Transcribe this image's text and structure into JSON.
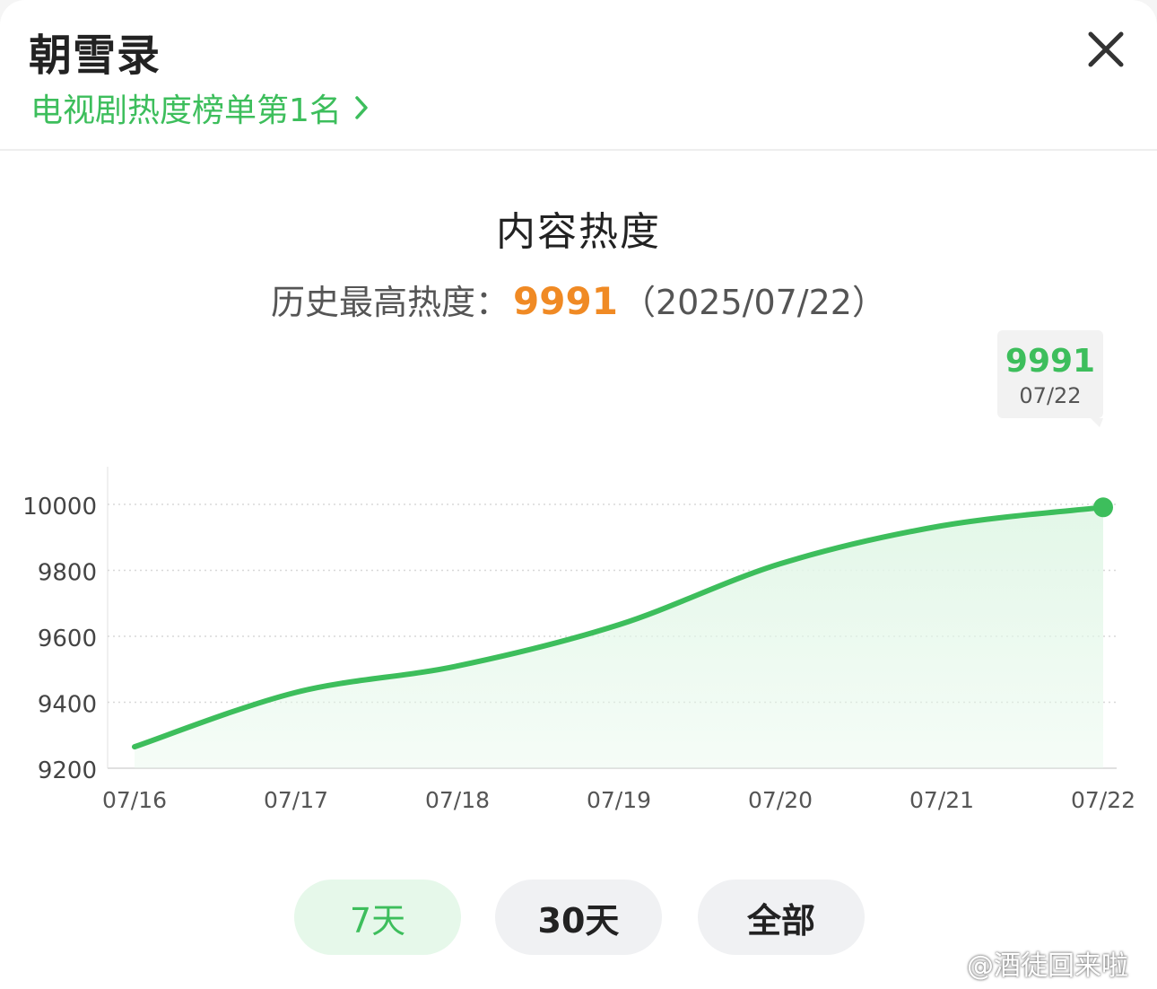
{
  "header": {
    "title": "朝雪录",
    "rank_link": "电视剧热度榜单第1名"
  },
  "heat": {
    "title": "内容热度",
    "peak_label": "历史最高热度：",
    "peak_value": "9991",
    "peak_date": "（2025/07/22）"
  },
  "tooltip": {
    "value": "9991",
    "date": "07/22"
  },
  "chart_data": {
    "type": "area",
    "title": "",
    "xlabel": "",
    "ylabel": "",
    "x": [
      "07/16",
      "07/17",
      "07/18",
      "07/19",
      "07/20",
      "07/21",
      "07/22"
    ],
    "y_ticks": [
      "9200",
      "9400",
      "9600",
      "9800",
      "10000"
    ],
    "ylim": [
      9200,
      10000
    ],
    "grid": true,
    "series": [
      {
        "values": [
          9265,
          9430,
          9510,
          9635,
          9820,
          9935,
          9991
        ]
      }
    ],
    "highlight": {
      "x": "07/22",
      "y": 9991
    },
    "colors": {
      "line": "#3dbe5c",
      "fill": "#e3f7e8"
    }
  },
  "range_buttons": [
    {
      "label": "7天",
      "active": true
    },
    {
      "label": "30天",
      "active": false
    },
    {
      "label": "全部",
      "active": false
    }
  ],
  "watermark": {
    "text": "@酒徒回来啦",
    "icon": "weibo-icon"
  },
  "icons": {
    "close": "close-icon",
    "chevron": "chevron-right-icon"
  },
  "colors": {
    "accent": "#3dbe5c",
    "peak": "#f08a24"
  }
}
